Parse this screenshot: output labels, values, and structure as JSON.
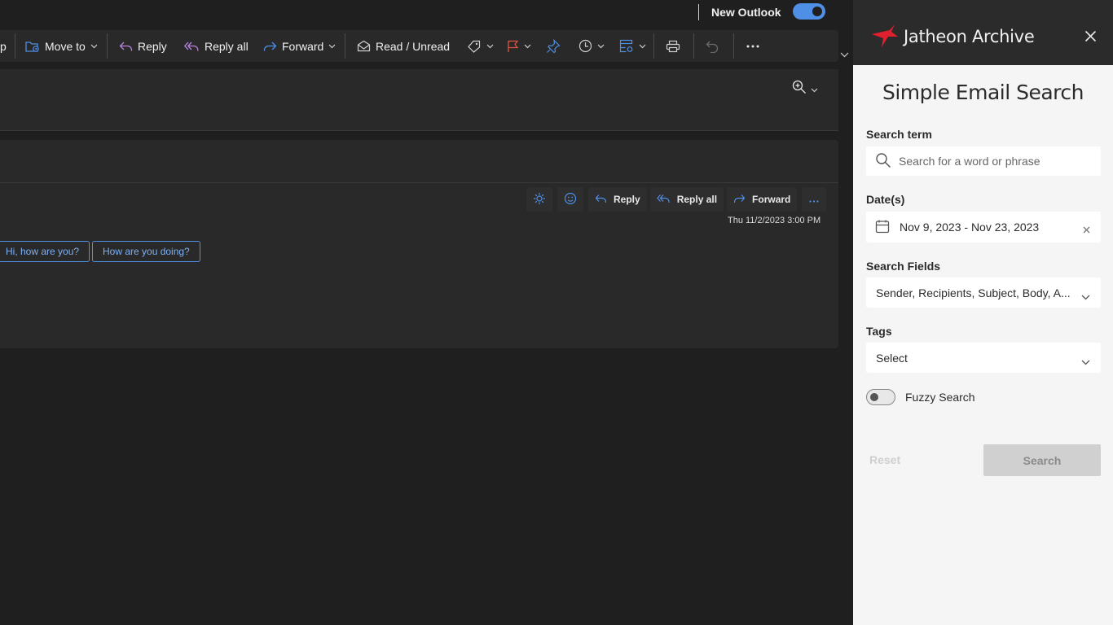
{
  "outlook": {
    "new_outlook_label": "New Outlook",
    "new_outlook_enabled": true,
    "ribbon": {
      "partial_left": "p",
      "move_to": "Move to",
      "reply": "Reply",
      "reply_all": "Reply all",
      "forward": "Forward",
      "read_unread": "Read / Unread"
    },
    "message": {
      "actions": {
        "reply": "Reply",
        "reply_all": "Reply all",
        "forward": "Forward"
      },
      "date": "Thu 11/2/2023 3:00 PM",
      "suggested_replies": [
        "Hi, how are you?",
        "How are you doing?"
      ]
    },
    "colors": {
      "accent": "#4f8fe6",
      "flag": "#e0533f",
      "reply_all_icon": "#b583d9"
    }
  },
  "jatheon": {
    "app_title": "Jatheon Archive",
    "heading": "Simple Email Search",
    "search_term": {
      "label": "Search term",
      "placeholder": "Search for a word or phrase",
      "value": ""
    },
    "dates": {
      "label": "Date(s)",
      "value": "Nov 9, 2023 - Nov 23, 2023"
    },
    "search_fields": {
      "label": "Search Fields",
      "value": "Sender, Recipients, Subject, Body, A..."
    },
    "tags": {
      "label": "Tags",
      "value": "Select"
    },
    "fuzzy_search": {
      "label": "Fuzzy Search",
      "enabled": false
    },
    "reset_label": "Reset",
    "search_label": "Search",
    "colors": {
      "brand": "#e0202e"
    }
  }
}
